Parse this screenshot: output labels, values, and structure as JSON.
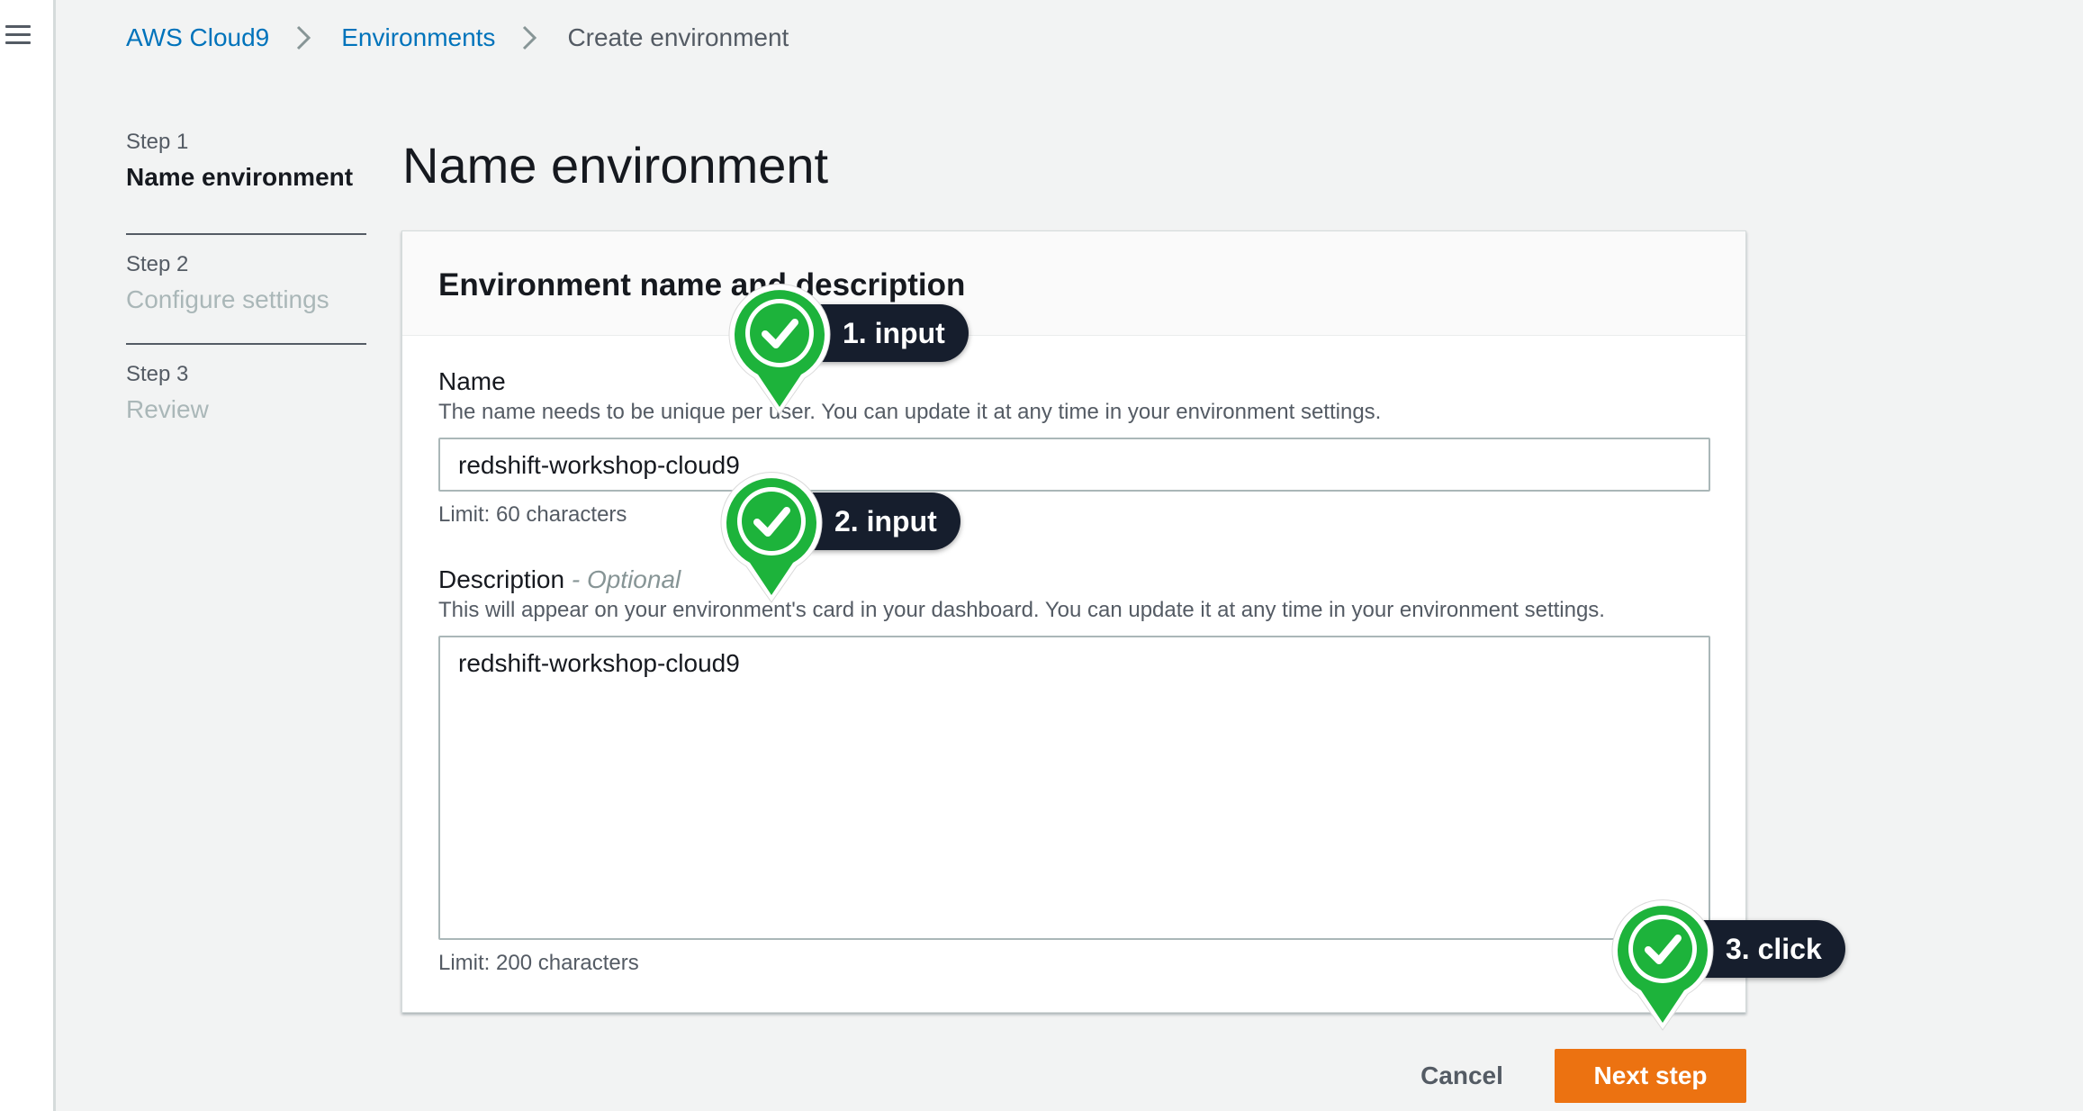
{
  "breadcrumb": {
    "items": [
      "AWS Cloud9",
      "Environments"
    ],
    "current": "Create environment"
  },
  "wizard": {
    "steps": [
      {
        "num": "Step 1",
        "title": "Name environment"
      },
      {
        "num": "Step 2",
        "title": "Configure settings"
      },
      {
        "num": "Step 3",
        "title": "Review"
      }
    ],
    "active_step": 1
  },
  "page": {
    "title": "Name environment"
  },
  "panel": {
    "title": "Environment name and description",
    "name_label": "Name",
    "name_description": "The name needs to be unique per user. You can update it at any time in your environment settings.",
    "name_value": "redshift-workshop-cloud9",
    "name_limit": "Limit: 60 characters",
    "desc_label": "Description",
    "desc_optional": "- Optional",
    "desc_description": "This will appear on your environment's card in your dashboard. You can update it at any time in your environment settings.",
    "desc_value": "redshift-workshop-cloud9",
    "desc_limit": "Limit: 200 characters"
  },
  "actions": {
    "cancel": "Cancel",
    "next": "Next step"
  },
  "annotations": [
    "1. input",
    "2. input",
    "3. click"
  ],
  "colors": {
    "link": "#0073bb",
    "primary_button": "#ec7211",
    "marker_green": "#1db33b",
    "marker_pill": "#161e2d"
  },
  "icons": [
    "hamburger-menu-icon",
    "chevron-right-icon",
    "check-icon"
  ]
}
